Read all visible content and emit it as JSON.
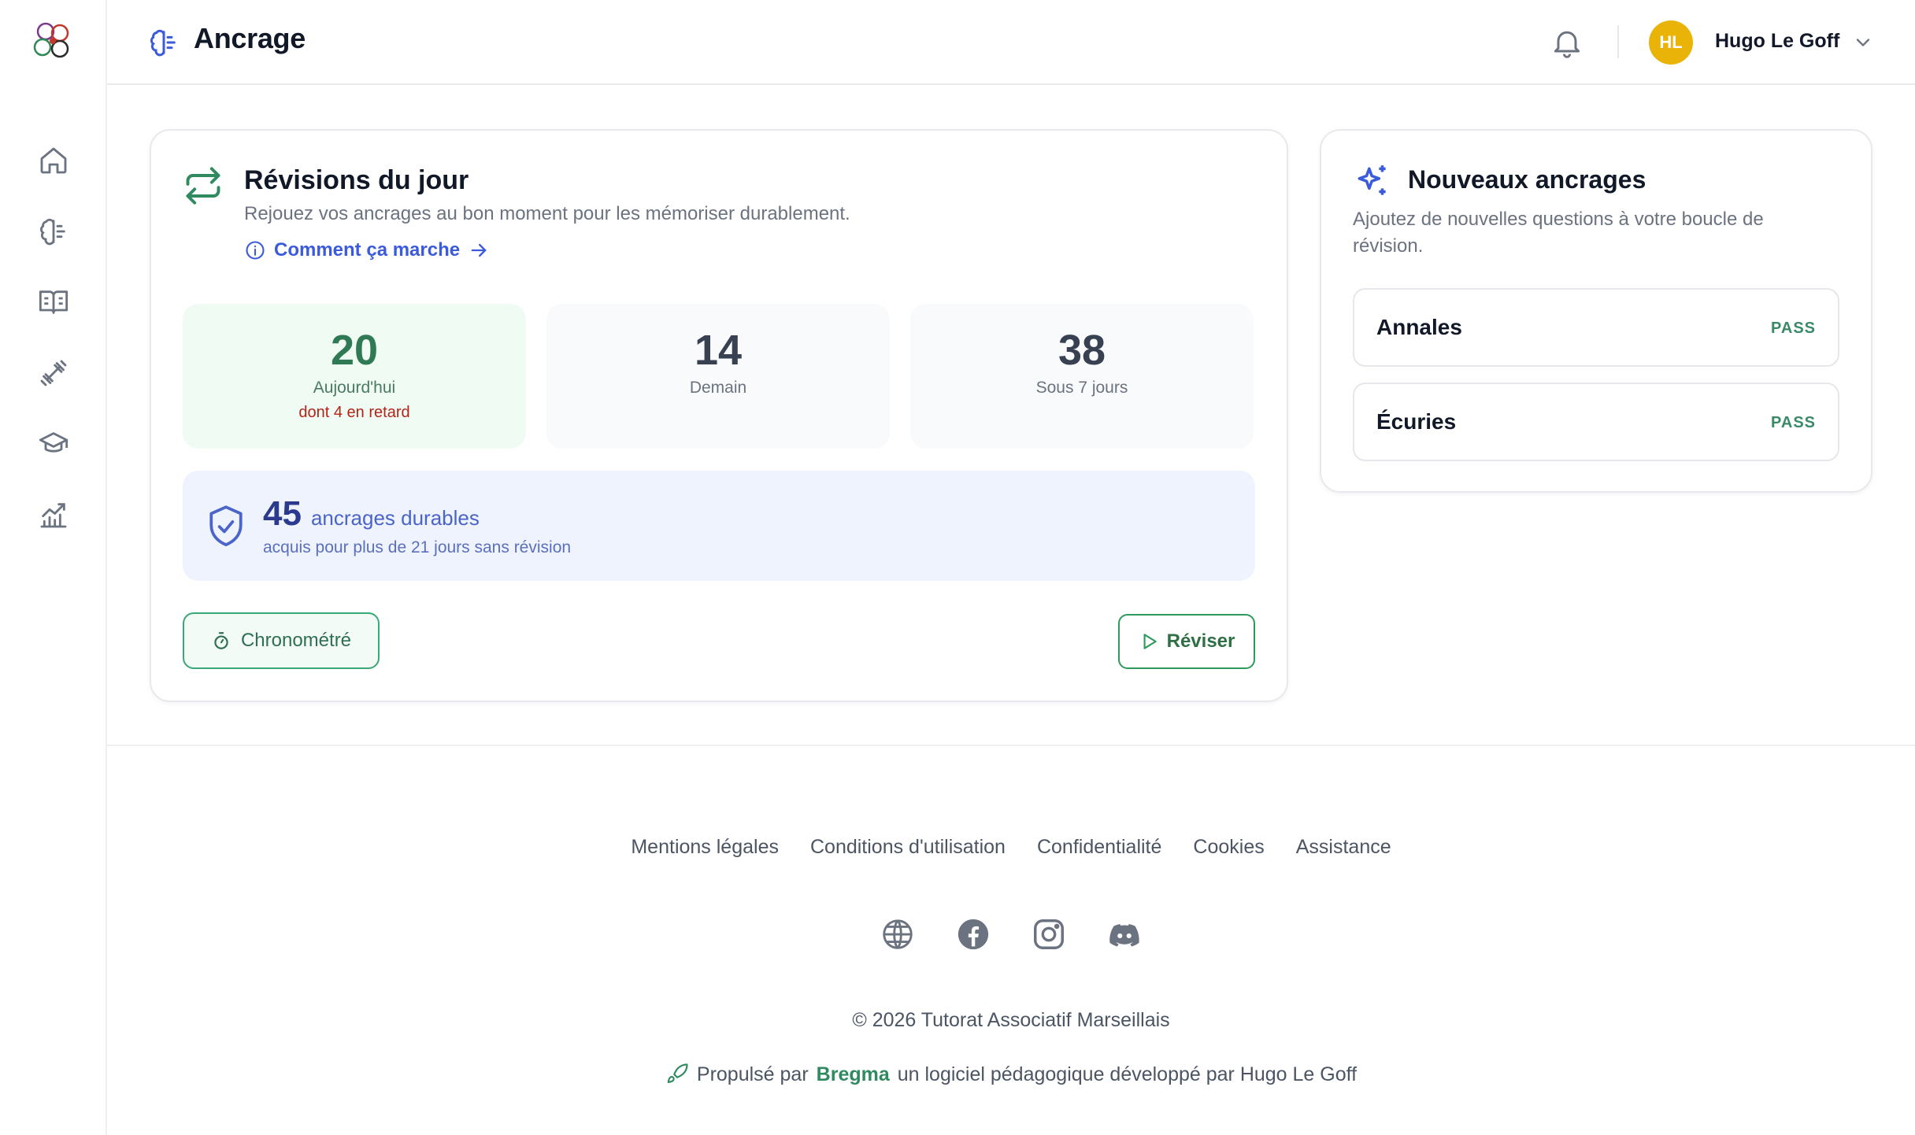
{
  "app": {
    "title": "Ancrage"
  },
  "sidebar": {
    "items": [
      {
        "name": "home",
        "icon": "home-icon"
      },
      {
        "name": "ancrage",
        "icon": "brain-icon"
      },
      {
        "name": "courses",
        "icon": "book-open-icon"
      },
      {
        "name": "training",
        "icon": "dumbbell-icon"
      },
      {
        "name": "school",
        "icon": "graduation-cap-icon"
      },
      {
        "name": "stats",
        "icon": "chart-icon"
      }
    ]
  },
  "header": {
    "user": {
      "initials": "HL",
      "name": "Hugo Le Goff",
      "avatar_color": "#eab308"
    }
  },
  "revisions": {
    "title": "Révisions du jour",
    "subtitle": "Rejouez vos ancrages au bon moment pour les mémoriser durablement.",
    "how_link": "Comment ça marche",
    "stats": [
      {
        "value": "20",
        "label": "Aujourd'hui",
        "late": "dont 4 en retard"
      },
      {
        "value": "14",
        "label": "Demain"
      },
      {
        "value": "38",
        "label": "Sous 7 jours"
      }
    ],
    "durable": {
      "count": "45",
      "label": "ancrages durables",
      "subtitle": "acquis pour plus de 21 jours sans révision"
    },
    "timed_button": "Chronométré",
    "review_button": "Réviser"
  },
  "new_anchors": {
    "title": "Nouveaux ancrages",
    "subtitle": "Ajoutez de nouvelles questions à votre boucle de révision.",
    "decks": [
      {
        "name": "Annales",
        "tag": "PASS"
      },
      {
        "name": "Écuries",
        "tag": "PASS"
      }
    ]
  },
  "footer": {
    "links": [
      "Mentions légales",
      "Conditions d'utilisation",
      "Confidentialité",
      "Cookies",
      "Assistance"
    ],
    "social": [
      "globe-icon",
      "facebook-icon",
      "instagram-icon",
      "discord-icon"
    ],
    "copyright": "© 2026 Tutorat Associatif Marseillais",
    "powered_prefix": "Propulsé par",
    "powered_brand": "Bregma",
    "powered_suffix": "un logiciel pédagogique développé par Hugo Le Goff"
  },
  "colors": {
    "accent_blue": "#3b5bdb",
    "accent_green": "#2f8a5f",
    "late_red": "#b42318"
  }
}
